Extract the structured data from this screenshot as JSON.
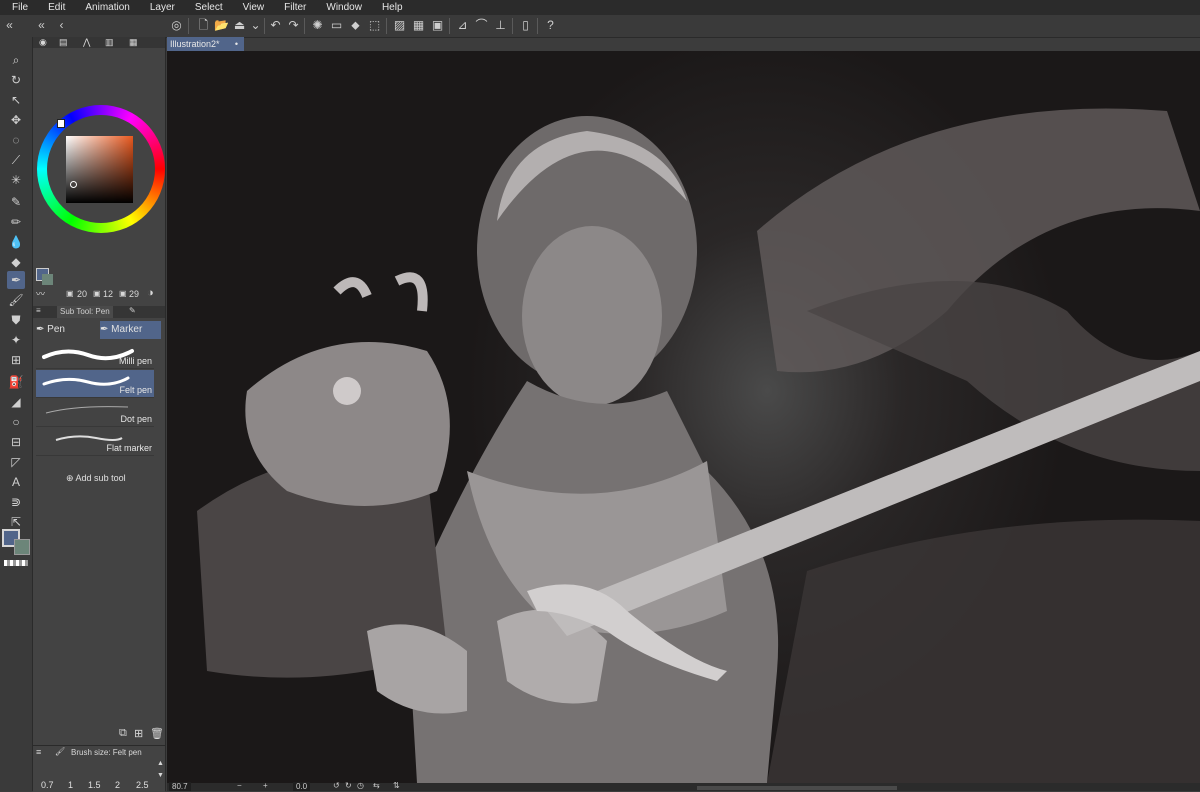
{
  "menu": [
    "File",
    "Edit",
    "Animation",
    "Layer",
    "Select",
    "View",
    "Filter",
    "Window",
    "Help"
  ],
  "document_tab": "Illustration2*",
  "subtool_panel": {
    "header": "Sub Tool: Pen",
    "tabs": [
      "Pen",
      "Marker"
    ],
    "brushes": [
      "Milli pen",
      "Felt pen",
      "Dot pen",
      "Flat marker"
    ],
    "add_label": "Add sub tool"
  },
  "color_panel": {
    "values": [
      "20",
      "12",
      "29"
    ]
  },
  "brush_size_panel": {
    "header": "Brush size: Felt pen",
    "sizes": [
      "0.7",
      "1",
      "1.5",
      "2",
      "2.5"
    ]
  },
  "status": {
    "zoom": "80.7",
    "angle": "0.0"
  },
  "colors": {
    "accent": "#51658a",
    "main_color": "#51658a",
    "sub_color": "#6c8579"
  }
}
